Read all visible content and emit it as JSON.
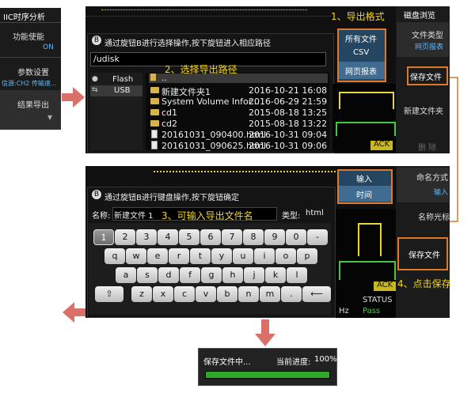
{
  "panel_left": {
    "title": "IIC时序分析",
    "func_label": "功能使能",
    "func_value": "ON",
    "param_label": "参数设置",
    "param_sub": "信源:CH2 传输速...",
    "result_label": "结果导出"
  },
  "panel_top": {
    "dialog_title": "通过旋钮B进行选择操作,按下旋钮进入相应路径",
    "path": "/udisk",
    "drives": [
      "Flash",
      "USB"
    ],
    "parent_dir": "..",
    "files": [
      {
        "name": "新建文件夹1",
        "date": "2016-10-21 16:08",
        "type": "folder"
      },
      {
        "name": "System Volume Infor...",
        "date": "2016-06-29 21:59",
        "type": "folder"
      },
      {
        "name": "cd1",
        "date": "2015-08-18 13:25",
        "type": "folder"
      },
      {
        "name": "cd2",
        "date": "2015-08-18 13:22",
        "type": "folder"
      },
      {
        "name": "20161031_090400.html",
        "date": "2016-10-31 09:04",
        "type": "file"
      },
      {
        "name": "20161031_090625.html",
        "date": "2016-10-31 09:06",
        "type": "file"
      }
    ],
    "format_options": [
      "所有文件",
      "CSV",
      "网页报表"
    ],
    "ack_label": "ACK",
    "side_title": "磁盘浏览",
    "side_type_label": "文件类型",
    "side_type_value": "网页报表",
    "side_save": "保存文件",
    "side_new_folder": "新建文件夹",
    "side_delete": "删 除"
  },
  "panel_mid": {
    "dialog_title": "通过旋钮B进行键盘操作,按下旋钮确定",
    "name_label": "名称:",
    "name_value": "新建文件 1",
    "type_label": "类型:",
    "type_value": "html",
    "naming_options": [
      "输入",
      "时间"
    ],
    "side_naming_label": "命名方式",
    "side_naming_value": "输入",
    "side_cursor": "名称光标",
    "side_save": "保存文件",
    "ack_label": "ACK",
    "status_header": "STATUS",
    "status_rows": [
      "Pass",
      "Pass",
      "Pass"
    ],
    "hz_label": "Hz",
    "keys_row1": [
      "1",
      "2",
      "3",
      "4",
      "5",
      "6",
      "7",
      "8",
      "9",
      "0",
      "-"
    ],
    "keys_row2": [
      "q",
      "w",
      "e",
      "r",
      "t",
      "y",
      "u",
      "i",
      "o",
      "p"
    ],
    "keys_row3": [
      "a",
      "s",
      "d",
      "f",
      "g",
      "h",
      "j",
      "k",
      "l"
    ],
    "keys_row4": [
      "⇧",
      "z",
      "x",
      "c",
      "v",
      "b",
      "n",
      "m",
      ".",
      "⟵"
    ]
  },
  "panel_bottom": {
    "status_text": "保存文件中...",
    "progress_label": "当前进度:",
    "progress_value": "100%",
    "progress_fraction": 1.0
  },
  "annotations": {
    "step1": "1、导出格式",
    "step2": "2、选择导出路径",
    "step3": "3、可输入导出文件名",
    "step4": "4、点击保存"
  },
  "colors": {
    "accent_orange": "#e0782c",
    "annotation_yellow": "#f3d51a",
    "arrow_red": "#d9706a",
    "progress_green": "#2fa82a",
    "link_blue": "#5bb8ff"
  }
}
